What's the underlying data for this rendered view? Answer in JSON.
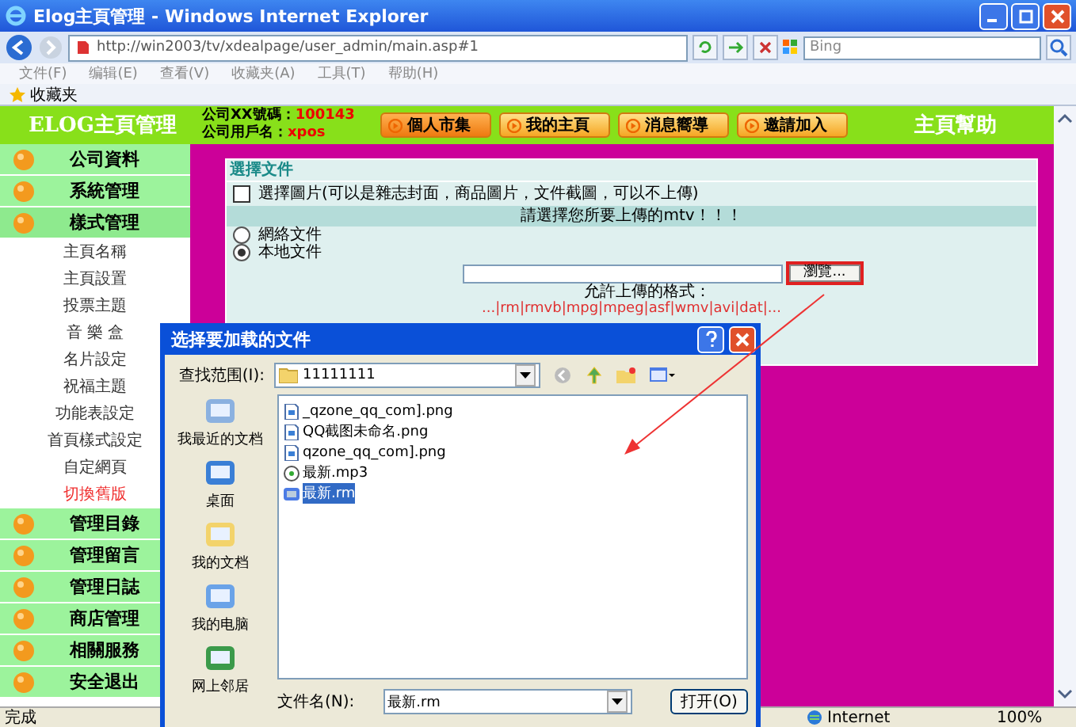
{
  "window": {
    "title": "Elog主頁管理 - Windows Internet Explorer"
  },
  "toolbar": {
    "address": "http://win2003/tv/xdealpage/user_admin/main.asp#1",
    "search_placeholder": "Bing"
  },
  "menu": [
    "文件(F)",
    "编辑(E)",
    "查看(V)",
    "收藏夹(A)",
    "工具(T)",
    "帮助(H)"
  ],
  "favorites": {
    "label": "收藏夹"
  },
  "header": {
    "logo": "ELOG主頁管理",
    "company_id_label": "公司XX號碼：",
    "company_id": "100143",
    "username_label": "公司用戶名：",
    "username": "xpos",
    "buttons": [
      "個人市集",
      "我的主頁",
      "消息嚮導",
      "邀請加入"
    ],
    "help": "主頁幫助"
  },
  "sidebar": {
    "items": [
      {
        "label": "公司資料",
        "expanded": false
      },
      {
        "label": "系統管理",
        "expanded": false
      },
      {
        "label": "樣式管理",
        "expanded": true,
        "children": [
          {
            "label": "主頁名稱",
            "highlighted": false
          },
          {
            "label": "主頁設置",
            "highlighted": false
          },
          {
            "label": "投票主題",
            "highlighted": false
          },
          {
            "label": "音 樂 盒",
            "highlighted": false
          },
          {
            "label": "名片設定",
            "highlighted": false
          },
          {
            "label": "祝福主題",
            "highlighted": false
          },
          {
            "label": "功能表設定",
            "highlighted": false
          },
          {
            "label": "首頁樣式設定",
            "highlighted": false
          },
          {
            "label": "自定網頁",
            "highlighted": false
          },
          {
            "label": "切換舊版",
            "highlighted": true
          }
        ]
      },
      {
        "label": "管理目錄",
        "expanded": false
      },
      {
        "label": "管理留言",
        "expanded": false
      },
      {
        "label": "管理日誌",
        "expanded": false
      },
      {
        "label": "商店管理",
        "expanded": false
      },
      {
        "label": "相關服務",
        "expanded": false
      },
      {
        "label": "安全退出",
        "expanded": false
      }
    ]
  },
  "content": {
    "panel_title": "選擇文件",
    "checkbox": {
      "label": "選擇圖片(可以是雜志封面，商品圖片，文件截圖，可以不上傳)",
      "checked": false
    },
    "notice": "請選擇您所要上傳的mtv！！！",
    "radios": [
      {
        "label": "網絡文件",
        "selected": false
      },
      {
        "label": "本地文件",
        "selected": true
      }
    ],
    "browse_button": "瀏覽...",
    "formats_label": "允許上傳的格式：",
    "formats": "...|rm|rmvb|mpg|mpeg|asf|wmv|avi|dat|..."
  },
  "dialog": {
    "title": "选择要加载的文件",
    "look_in_label": "查找范围(I):",
    "look_in": "11111111",
    "places": [
      "我最近的文档",
      "桌面",
      "我的文档",
      "我的电脑",
      "网上邻居"
    ],
    "files": [
      {
        "name": "_qzone_qq_com].png",
        "kind": "image",
        "selected": false
      },
      {
        "name": "QQ截图未命名.png",
        "kind": "image",
        "selected": false
      },
      {
        "name": "qzone_qq_com].png",
        "kind": "image",
        "selected": false
      },
      {
        "name": "最新.mp3",
        "kind": "audio",
        "selected": false
      },
      {
        "name": "最新.rm",
        "kind": "video",
        "selected": true
      }
    ],
    "file_name_label": "文件名(N):",
    "file_name": "最新.rm",
    "open_button": "打开(O)"
  },
  "status_bar": {
    "text": "完成",
    "zone": "Internet",
    "zoom": "100%"
  }
}
